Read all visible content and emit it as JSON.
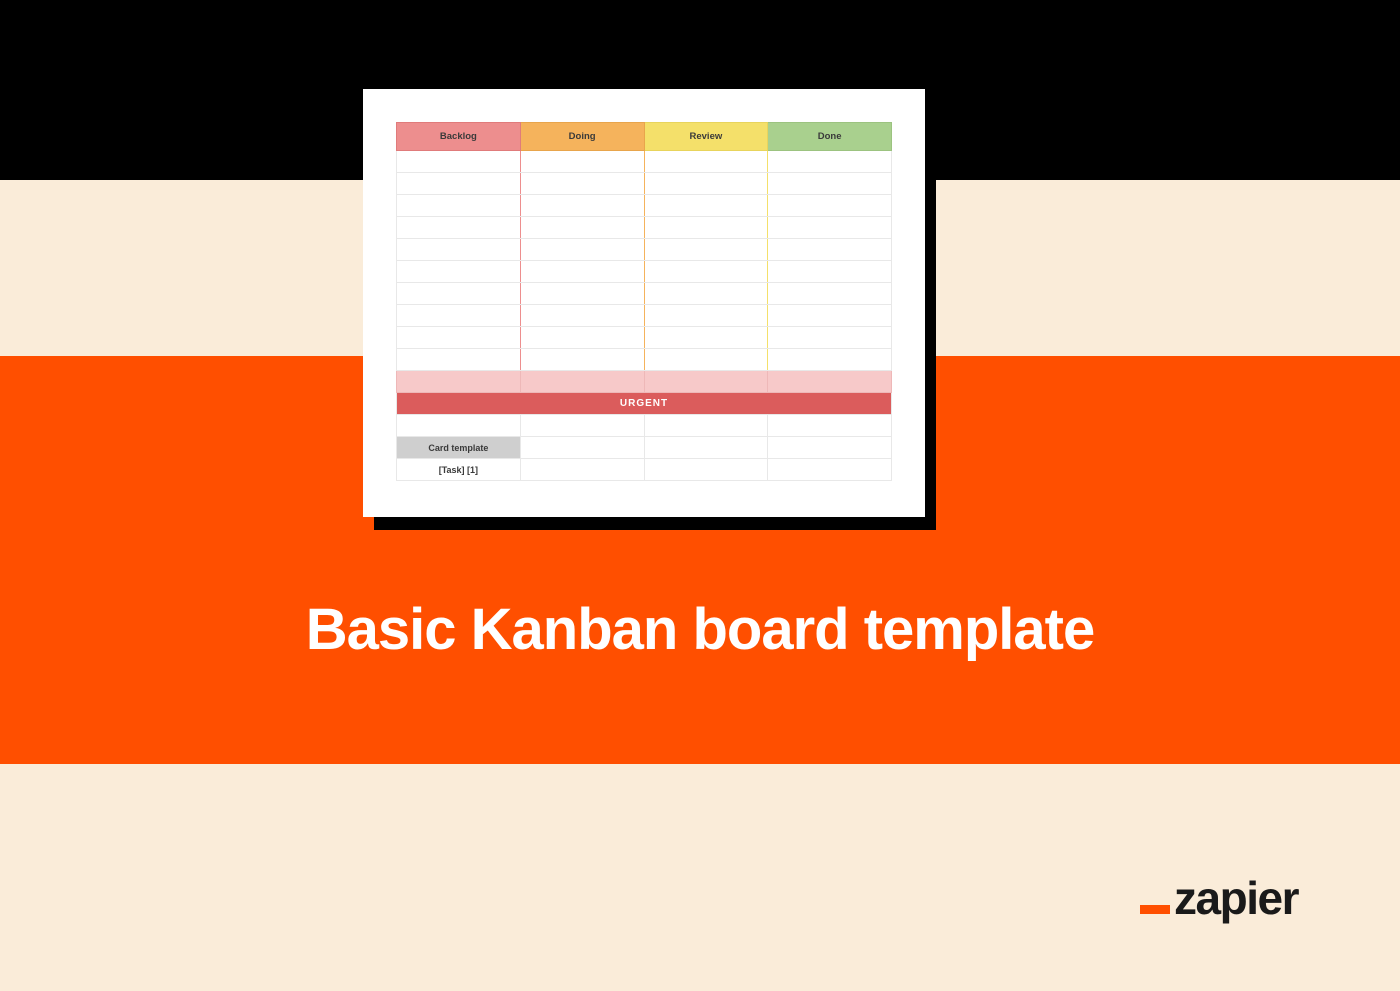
{
  "title": "Basic Kanban board template",
  "logo_text": "zapier",
  "kanban": {
    "columns": [
      "Backlog",
      "Doing",
      "Review",
      "Done"
    ],
    "urgent_label": "URGENT",
    "card_template_label": "Card template",
    "task_placeholder": "[Task] [1]",
    "empty_rows": 10
  }
}
